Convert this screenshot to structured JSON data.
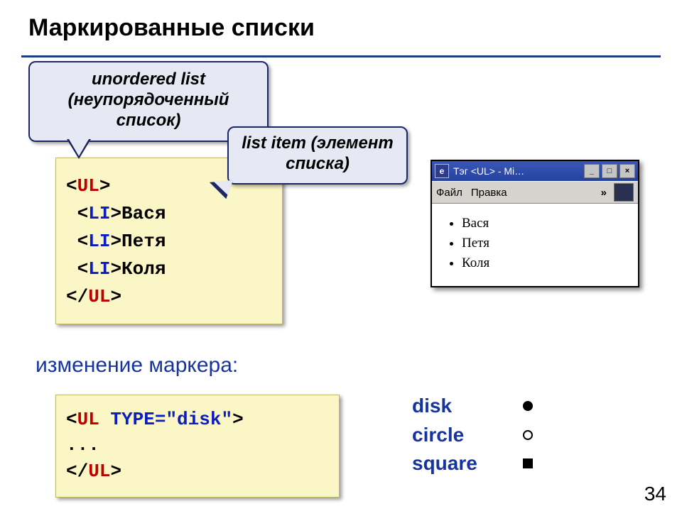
{
  "title": "Маркированные списки",
  "callouts": {
    "unordered": "unordered list (неупорядоченный список)",
    "list_item": "list item (элемент списка)"
  },
  "code1": {
    "open_b": "<",
    "close_b": ">",
    "slash": "/",
    "ul": "UL",
    "li": "LI",
    "items": [
      "Вася",
      "Петя",
      "Коля"
    ]
  },
  "browser": {
    "title": "Тэг <UL> - Mi…",
    "menu": {
      "file": "Файл",
      "edit": "Правка",
      "more": "»"
    },
    "list": [
      "Вася",
      "Петя",
      "Коля"
    ]
  },
  "subhead": "изменение маркера:",
  "code2": {
    "line1_open": "<",
    "line1_tag": "UL",
    "line1_attr": " TYPE=\"disk\"",
    "line1_close": ">",
    "line2": "...",
    "line3_open": "</",
    "line3_tag": "UL",
    "line3_close": ">"
  },
  "markers": {
    "disk": "disk",
    "circle": "circle",
    "square": "square"
  },
  "page": "34"
}
